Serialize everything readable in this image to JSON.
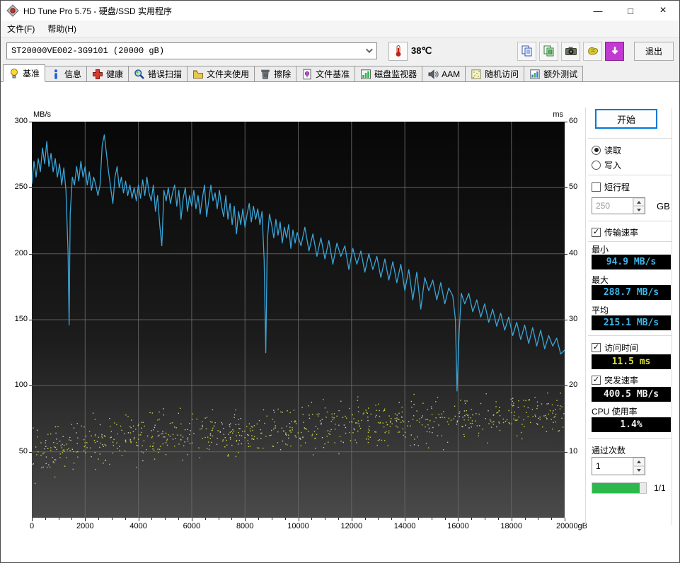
{
  "window": {
    "title": "HD Tune Pro 5.75 - 硬盘/SSD 实用程序",
    "controls": {
      "minimize": "—",
      "maximize": "□",
      "close": "×"
    }
  },
  "menu": {
    "items": [
      {
        "label": "文件(F)"
      },
      {
        "label": "帮助(H)"
      }
    ]
  },
  "toolbar": {
    "drive_selector": "ST20000VE002-3G9101 (20000 gB)",
    "temperature": "38℃",
    "exit_label": "退出"
  },
  "tabs": [
    {
      "label": "基准",
      "icon": "lamp-icon",
      "active": true
    },
    {
      "label": "信息",
      "icon": "info-icon"
    },
    {
      "label": "健康",
      "icon": "health-cross-icon"
    },
    {
      "label": "错误扫描",
      "icon": "magnifier-icon"
    },
    {
      "label": "文件夹使用",
      "icon": "folder-icon"
    },
    {
      "label": "擦除",
      "icon": "trash-icon"
    },
    {
      "label": "文件基准",
      "icon": "file-benchmark-icon"
    },
    {
      "label": "磁盘监视器",
      "icon": "bar-chart-icon"
    },
    {
      "label": "AAM",
      "icon": "speaker-icon"
    },
    {
      "label": "随机访问",
      "icon": "random-dots-icon"
    },
    {
      "label": "额外测试",
      "icon": "extra-tests-icon"
    }
  ],
  "panel": {
    "start_label": "开始",
    "read_label": "读取",
    "write_label": "写入",
    "short_stroke_label": "短行程",
    "short_stroke_value": "250",
    "short_stroke_unit": "GB",
    "transfer_rate_label": "传输速率",
    "min_label": "最小",
    "min_value": "94.9 MB/s",
    "max_label": "最大",
    "max_value": "288.7 MB/s",
    "avg_label": "平均",
    "avg_value": "215.1 MB/s",
    "access_time_label": "访问时间",
    "access_time_value": "11.5 ms",
    "burst_rate_label": "突发速率",
    "burst_rate_value": "400.5 MB/s",
    "cpu_label": "CPU 使用率",
    "cpu_value": "1.4%",
    "pass_count_label": "通过次数",
    "pass_count_value": "1",
    "progress_label": "1/1",
    "progress_percent": 88
  },
  "chart_data": {
    "type": "line+scatter",
    "left_axis": {
      "label": "MB/s",
      "min": 0,
      "max": 300,
      "ticks": [
        300,
        250,
        200,
        150,
        100,
        50
      ]
    },
    "right_axis": {
      "label": "ms",
      "min": 0,
      "max": 60,
      "ticks": [
        60,
        50,
        40,
        30,
        20,
        10
      ]
    },
    "x_axis": {
      "min": 0,
      "max": 20000,
      "ticks": [
        0,
        2000,
        4000,
        6000,
        8000,
        10000,
        12000,
        14000,
        16000,
        18000,
        20000
      ],
      "last_tick_label": "20000gB",
      "minor_step": 500
    },
    "colors": {
      "line": "#3aa5d8",
      "scatter": "#c9cf3f",
      "scatter2": "#cccccc",
      "grid": "#6a6a6a",
      "bg_top": "#070707",
      "bg_mid": "#1c1c1c",
      "bg_bottom": "#4a4a4a"
    },
    "series": [
      {
        "name": "transfer-rate",
        "unit": "MB/s",
        "points": [
          [
            0,
            253
          ],
          [
            80,
            270
          ],
          [
            160,
            258
          ],
          [
            240,
            272
          ],
          [
            320,
            262
          ],
          [
            400,
            280
          ],
          [
            480,
            268
          ],
          [
            560,
            285
          ],
          [
            640,
            266
          ],
          [
            720,
            276
          ],
          [
            800,
            262
          ],
          [
            880,
            272
          ],
          [
            960,
            258
          ],
          [
            1040,
            268
          ],
          [
            1120,
            252
          ],
          [
            1200,
            265
          ],
          [
            1280,
            248
          ],
          [
            1360,
            200
          ],
          [
            1400,
            146
          ],
          [
            1440,
            230
          ],
          [
            1520,
            258
          ],
          [
            1600,
            252
          ],
          [
            1680,
            266
          ],
          [
            1760,
            255
          ],
          [
            1840,
            270
          ],
          [
            1920,
            258
          ],
          [
            2000,
            266
          ],
          [
            2080,
            252
          ],
          [
            2160,
            262
          ],
          [
            2240,
            248
          ],
          [
            2320,
            258
          ],
          [
            2400,
            252
          ],
          [
            2480,
            244
          ],
          [
            2560,
            252
          ],
          [
            2640,
            282
          ],
          [
            2720,
            290
          ],
          [
            2800,
            276
          ],
          [
            2880,
            262
          ],
          [
            2960,
            250
          ],
          [
            3040,
            238
          ],
          [
            3120,
            258
          ],
          [
            3200,
            266
          ],
          [
            3280,
            250
          ],
          [
            3360,
            258
          ],
          [
            3440,
            246
          ],
          [
            3520,
            255
          ],
          [
            3600,
            244
          ],
          [
            3680,
            252
          ],
          [
            3760,
            242
          ],
          [
            3840,
            250
          ],
          [
            3920,
            240
          ],
          [
            4000,
            252
          ],
          [
            4080,
            242
          ],
          [
            4160,
            256
          ],
          [
            4240,
            244
          ],
          [
            4320,
            258
          ],
          [
            4400,
            246
          ],
          [
            4480,
            240
          ],
          [
            4560,
            252
          ],
          [
            4640,
            232
          ],
          [
            4720,
            244
          ],
          [
            4800,
            222
          ],
          [
            4880,
            206
          ],
          [
            4960,
            248
          ],
          [
            5040,
            240
          ],
          [
            5120,
            250
          ],
          [
            5200,
            238
          ],
          [
            5280,
            246
          ],
          [
            5360,
            252
          ],
          [
            5440,
            236
          ],
          [
            5520,
            248
          ],
          [
            5600,
            226
          ],
          [
            5680,
            242
          ],
          [
            5760,
            250
          ],
          [
            5840,
            232
          ],
          [
            5920,
            244
          ],
          [
            6000,
            236
          ],
          [
            6080,
            248
          ],
          [
            6160,
            234
          ],
          [
            6240,
            244
          ],
          [
            6320,
            230
          ],
          [
            6400,
            242
          ],
          [
            6480,
            252
          ],
          [
            6560,
            228
          ],
          [
            6640,
            240
          ],
          [
            6720,
            252
          ],
          [
            6800,
            240
          ],
          [
            6880,
            246
          ],
          [
            6960,
            234
          ],
          [
            7040,
            248
          ],
          [
            7120,
            236
          ],
          [
            7200,
            228
          ],
          [
            7280,
            244
          ],
          [
            7360,
            226
          ],
          [
            7440,
            238
          ],
          [
            7520,
            222
          ],
          [
            7600,
            236
          ],
          [
            7680,
            215
          ],
          [
            7760,
            232
          ],
          [
            7840,
            222
          ],
          [
            7920,
            234
          ],
          [
            8000,
            220
          ],
          [
            8080,
            230
          ],
          [
            8160,
            238
          ],
          [
            8240,
            224
          ],
          [
            8320,
            236
          ],
          [
            8400,
            226
          ],
          [
            8480,
            234
          ],
          [
            8560,
            222
          ],
          [
            8640,
            232
          ],
          [
            8720,
            195
          ],
          [
            8780,
            125
          ],
          [
            8840,
            210
          ],
          [
            8920,
            230
          ],
          [
            9000,
            222
          ],
          [
            9080,
            212
          ],
          [
            9160,
            226
          ],
          [
            9240,
            214
          ],
          [
            9320,
            224
          ],
          [
            9400,
            208
          ],
          [
            9480,
            220
          ],
          [
            9560,
            212
          ],
          [
            9640,
            222
          ],
          [
            9720,
            204
          ],
          [
            9800,
            218
          ],
          [
            9880,
            208
          ],
          [
            9960,
            216
          ],
          [
            10100,
            206
          ],
          [
            10250,
            220
          ],
          [
            10400,
            202
          ],
          [
            10550,
            215
          ],
          [
            10700,
            198
          ],
          [
            10850,
            212
          ],
          [
            11000,
            196
          ],
          [
            11150,
            210
          ],
          [
            11300,
            192
          ],
          [
            11450,
            208
          ],
          [
            11600,
            198
          ],
          [
            11750,
            206
          ],
          [
            11900,
            188
          ],
          [
            12050,
            204
          ],
          [
            12200,
            192
          ],
          [
            12350,
            202
          ],
          [
            12500,
            186
          ],
          [
            12650,
            200
          ],
          [
            12800,
            188
          ],
          [
            12950,
            198
          ],
          [
            13100,
            182
          ],
          [
            13250,
            196
          ],
          [
            13400,
            180
          ],
          [
            13550,
            194
          ],
          [
            13700,
            178
          ],
          [
            13850,
            192
          ],
          [
            14000,
            172
          ],
          [
            14150,
            188
          ],
          [
            14300,
            165
          ],
          [
            14450,
            186
          ],
          [
            14600,
            158
          ],
          [
            14750,
            182
          ],
          [
            14900,
            172
          ],
          [
            15050,
            180
          ],
          [
            15200,
            165
          ],
          [
            15350,
            178
          ],
          [
            15500,
            162
          ],
          [
            15650,
            174
          ],
          [
            15800,
            168
          ],
          [
            15900,
            150
          ],
          [
            15960,
            96
          ],
          [
            16040,
            140
          ],
          [
            16120,
            170
          ],
          [
            16250,
            162
          ],
          [
            16400,
            170
          ],
          [
            16550,
            156
          ],
          [
            16700,
            165
          ],
          [
            16850,
            152
          ],
          [
            17000,
            162
          ],
          [
            17150,
            148
          ],
          [
            17300,
            158
          ],
          [
            17450,
            145
          ],
          [
            17600,
            155
          ],
          [
            17750,
            142
          ],
          [
            17900,
            152
          ],
          [
            18050,
            138
          ],
          [
            18200,
            148
          ],
          [
            18350,
            135
          ],
          [
            18500,
            146
          ],
          [
            18650,
            132
          ],
          [
            18800,
            144
          ],
          [
            18950,
            130
          ],
          [
            19100,
            142
          ],
          [
            19250,
            128
          ],
          [
            19400,
            138
          ],
          [
            19550,
            130
          ],
          [
            19700,
            136
          ],
          [
            19850,
            124
          ],
          [
            20000,
            127
          ]
        ]
      }
    ],
    "access_time_scatter": {
      "name": "access-time",
      "unit": "ms",
      "count": 650,
      "count2": 170,
      "seed": 42,
      "band": [
        [
          0,
          9.5,
          3.5
        ],
        [
          2000,
          11.5,
          3.5
        ],
        [
          5000,
          12.5,
          3.5
        ],
        [
          8000,
          13,
          3.5
        ],
        [
          12000,
          14,
          3.5
        ],
        [
          16000,
          15,
          3.3
        ],
        [
          20000,
          15.8,
          3.0
        ]
      ]
    },
    "summary": {
      "min_mbps": 94.9,
      "max_mbps": 288.7,
      "avg_mbps": 215.1,
      "access_ms": 11.5,
      "burst_mbps": 400.5,
      "cpu_pct": 1.4
    }
  }
}
